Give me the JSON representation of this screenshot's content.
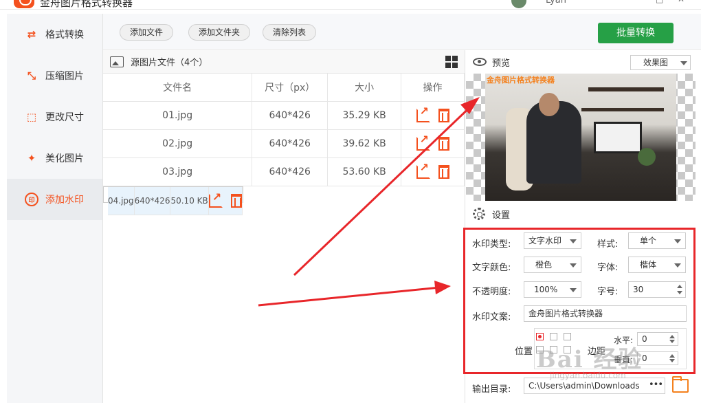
{
  "app": {
    "title": "金舟图片格式转换器",
    "user": "Lyan"
  },
  "sidebar": {
    "items": [
      {
        "label": "格式转换",
        "icon": "format-convert-icon"
      },
      {
        "label": "压缩图片",
        "icon": "compress-icon"
      },
      {
        "label": "更改尺寸",
        "icon": "resize-icon"
      },
      {
        "label": "美化图片",
        "icon": "beautify-icon"
      },
      {
        "label": "添加水印",
        "icon": "watermark-icon",
        "active": true
      }
    ]
  },
  "toolbar": {
    "add_file": "添加文件",
    "add_folder": "添加文件夹",
    "clear_list": "清除列表",
    "batch_convert": "批量转换"
  },
  "file_panel": {
    "title": "源图片文件（4个）",
    "columns": [
      "文件名",
      "尺寸（px）",
      "大小",
      "操作"
    ],
    "rows": [
      [
        "01.jpg",
        "640*426",
        "35.29 KB"
      ],
      [
        "02.jpg",
        "640*426",
        "39.62 KB"
      ],
      [
        "03.jpg",
        "640*426",
        "53.60 KB"
      ],
      [
        "04.jpg",
        "640*426",
        "50.10 KB"
      ]
    ],
    "selected_row": 3
  },
  "preview": {
    "label": "预览",
    "mode": "效果图",
    "watermark_text": "金舟图片格式转换器"
  },
  "settings": {
    "label": "设置",
    "watermark_type_label": "水印类型:",
    "watermark_type": "文字水印",
    "style_label": "样式:",
    "style": "单个",
    "text_color_label": "文字颜色:",
    "text_color": "橙色",
    "font_label": "字体:",
    "font": "楷体",
    "opacity_label": "不透明度:",
    "opacity": "100%",
    "size_label": "字号:",
    "size": "30",
    "text_label": "水印文案:",
    "text": "金舟图片格式转换器",
    "position_label": "位置",
    "margin_label": "边距",
    "horizontal_label": "水平:",
    "horizontal": "0",
    "vertical_label": "垂直:",
    "vertical": "0"
  },
  "output": {
    "label": "输出目录:",
    "path": "C:\\Users\\admin\\Downloads",
    "browse": "•••"
  },
  "overlay": {
    "baidu": "Bai 经验",
    "baidu_url": "jingyan.baidu.com"
  },
  "colors": {
    "accent": "#f4511e",
    "batch": "#26a046",
    "annotation": "#e8262a"
  }
}
